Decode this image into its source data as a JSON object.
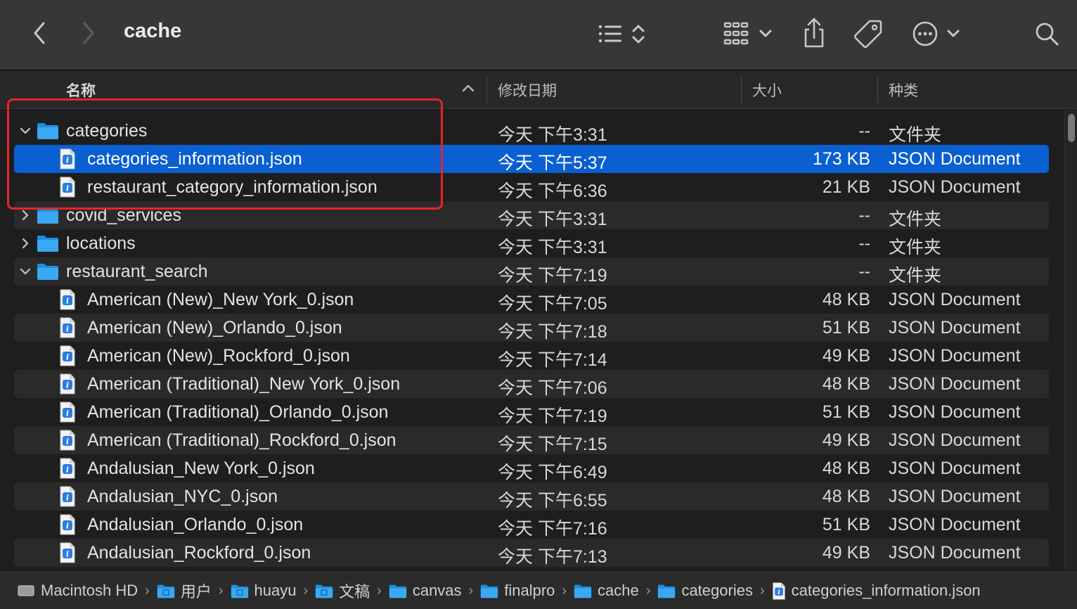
{
  "window": {
    "title": "cache"
  },
  "columns": {
    "name": "名称",
    "date": "修改日期",
    "size": "大小",
    "kind": "种类"
  },
  "rows": [
    {
      "name": "categories",
      "date": "今天 下午3:31",
      "size": "--",
      "kind": "文件夹",
      "type": "folder",
      "expanded": true,
      "indent": 0
    },
    {
      "name": "categories_information.json",
      "date": "今天 下午5:37",
      "size": "173 KB",
      "kind": "JSON Document",
      "type": "file",
      "indent": 1,
      "selected": true
    },
    {
      "name": "restaurant_category_information.json",
      "date": "今天 下午6:36",
      "size": "21 KB",
      "kind": "JSON Document",
      "type": "file",
      "indent": 1
    },
    {
      "name": "covid_services",
      "date": "今天 下午3:31",
      "size": "--",
      "kind": "文件夹",
      "type": "folder",
      "expanded": false,
      "indent": 0
    },
    {
      "name": "locations",
      "date": "今天 下午3:31",
      "size": "--",
      "kind": "文件夹",
      "type": "folder",
      "expanded": false,
      "indent": 0
    },
    {
      "name": "restaurant_search",
      "date": "今天 下午7:19",
      "size": "--",
      "kind": "文件夹",
      "type": "folder",
      "expanded": true,
      "indent": 0
    },
    {
      "name": "American (New)_New York_0.json",
      "date": "今天 下午7:05",
      "size": "48 KB",
      "kind": "JSON Document",
      "type": "file",
      "indent": 1
    },
    {
      "name": "American (New)_Orlando_0.json",
      "date": "今天 下午7:18",
      "size": "51 KB",
      "kind": "JSON Document",
      "type": "file",
      "indent": 1
    },
    {
      "name": "American (New)_Rockford_0.json",
      "date": "今天 下午7:14",
      "size": "49 KB",
      "kind": "JSON Document",
      "type": "file",
      "indent": 1
    },
    {
      "name": "American (Traditional)_New York_0.json",
      "date": "今天 下午7:06",
      "size": "48 KB",
      "kind": "JSON Document",
      "type": "file",
      "indent": 1
    },
    {
      "name": "American (Traditional)_Orlando_0.json",
      "date": "今天 下午7:19",
      "size": "51 KB",
      "kind": "JSON Document",
      "type": "file",
      "indent": 1
    },
    {
      "name": "American (Traditional)_Rockford_0.json",
      "date": "今天 下午7:15",
      "size": "49 KB",
      "kind": "JSON Document",
      "type": "file",
      "indent": 1
    },
    {
      "name": "Andalusian_New York_0.json",
      "date": "今天 下午6:49",
      "size": "48 KB",
      "kind": "JSON Document",
      "type": "file",
      "indent": 1
    },
    {
      "name": "Andalusian_NYC_0.json",
      "date": "今天 下午6:55",
      "size": "48 KB",
      "kind": "JSON Document",
      "type": "file",
      "indent": 1
    },
    {
      "name": "Andalusian_Orlando_0.json",
      "date": "今天 下午7:16",
      "size": "51 KB",
      "kind": "JSON Document",
      "type": "file",
      "indent": 1
    },
    {
      "name": "Andalusian_Rockford_0.json",
      "date": "今天 下午7:13",
      "size": "49 KB",
      "kind": "JSON Document",
      "type": "file",
      "indent": 1
    }
  ],
  "path": [
    {
      "label": "Macintosh HD",
      "icon": "disk-icon"
    },
    {
      "label": "用户",
      "icon": "users-folder-icon"
    },
    {
      "label": "huayu",
      "icon": "home-folder-icon"
    },
    {
      "label": "文稿",
      "icon": "documents-folder-icon"
    },
    {
      "label": "canvas",
      "icon": "folder-icon"
    },
    {
      "label": "finalpro",
      "icon": "folder-icon"
    },
    {
      "label": "cache",
      "icon": "folder-icon"
    },
    {
      "label": "categories",
      "icon": "folder-icon"
    },
    {
      "label": "categories_information.json",
      "icon": "json-file-icon"
    }
  ],
  "colors": {
    "selection": "#0a5fd1",
    "folder": "#1e9bf0",
    "highlight_box": "#e5252a"
  }
}
